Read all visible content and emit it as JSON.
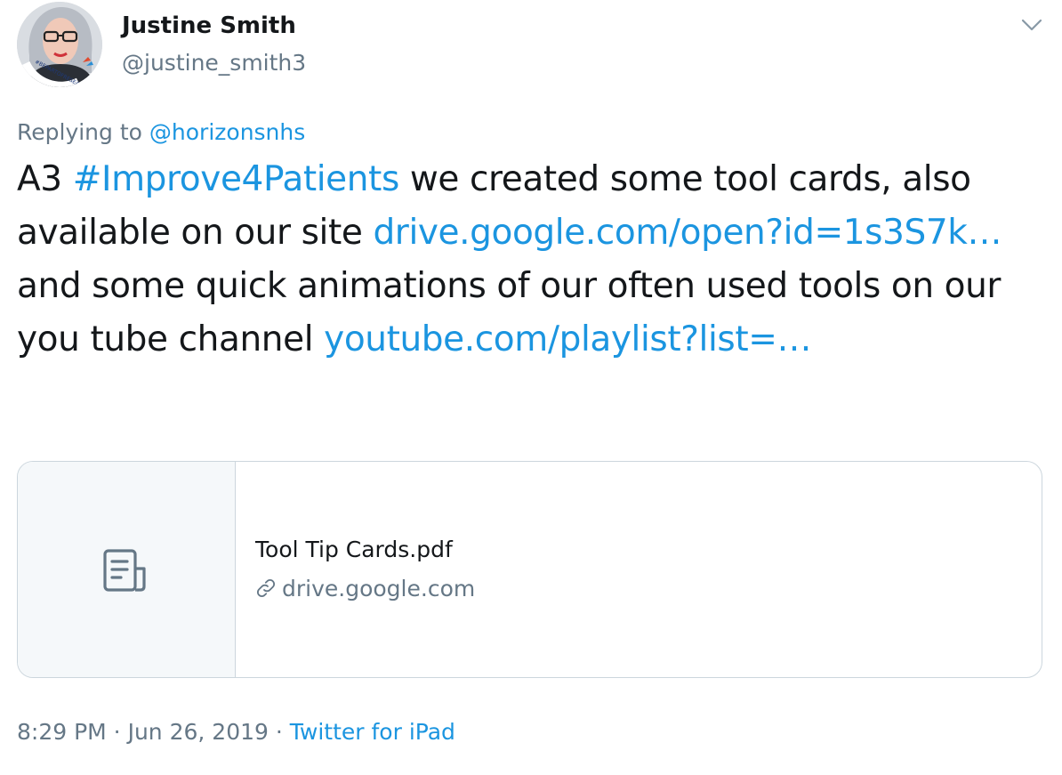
{
  "author": {
    "display_name": "Justine Smith",
    "handle": "@justine_smith3",
    "avatar_badge_text": "#BEPARTOFRESEARCH"
  },
  "reply": {
    "prefix": "Replying to",
    "mention": "@horizonsnhs"
  },
  "tweet": {
    "seg1": "A3 ",
    "hashtag": "#Improve4Patients",
    "seg2": " we created some tool cards, also available on our site ",
    "link1": "drive.google.com/open?id=1s3S7k…",
    "seg3": "  and some quick animations of our often used tools on our you tube channel ",
    "link2": "youtube.com/playlist?list=…"
  },
  "card": {
    "title": "Tool Tip Cards.pdf",
    "domain": "drive.google.com",
    "thumbnail_icon": "document-icon"
  },
  "meta": {
    "time": "8:29 PM",
    "separator1": " · ",
    "date": "Jun 26, 2019",
    "separator2": " · ",
    "source": "Twitter for iPad"
  },
  "icons": {
    "caret": "chevron-down-icon",
    "link": "link-icon"
  },
  "colors": {
    "link": "#1b95e0",
    "text": "#14171a",
    "secondary": "#657786",
    "border": "#ccd6dd",
    "card_thumb_bg": "#f5f8fa"
  }
}
